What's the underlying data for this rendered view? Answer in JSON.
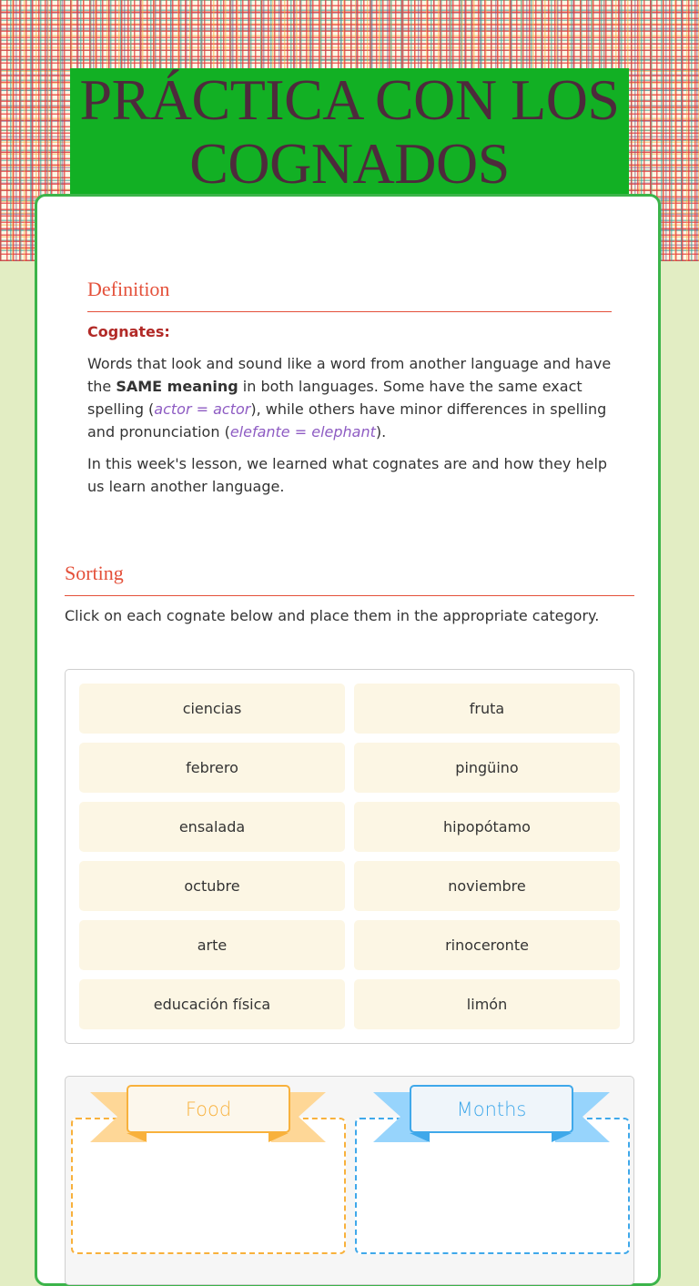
{
  "header": {
    "title_line1": "PRÁCTICA CON LOS",
    "title_line2": "COGNADOS"
  },
  "definition": {
    "heading": "Definition",
    "term": "Cognates:",
    "para1": {
      "a": "Words that look and sound like a word from another language and have the ",
      "bold": "SAME meaning",
      "b": " in both languages.  Some have the same exact spelling (",
      "ex1a": "actor",
      "eq1": " = ",
      "ex1b": "actor",
      "c": "), while others have minor differences in spelling and pronunciation (",
      "ex2a": "elefante",
      "eq2": " = ",
      "ex2b": "elephant",
      "d": ")."
    },
    "para2": "In this week's lesson, we learned what cognates are and how they help us learn another language."
  },
  "sorting": {
    "heading": "Sorting",
    "instructions": "Click on each cognate below and place them in the appropriate category.",
    "items": [
      "ciencias",
      "fruta",
      "febrero",
      "pingüino",
      "ensalada",
      "hipopótamo",
      "octubre",
      "noviembre",
      "arte",
      "rinoceronte",
      "educación física",
      "limón"
    ],
    "categories": [
      {
        "label": "Food",
        "color": "#f8b13c"
      },
      {
        "label": "Months",
        "color": "#3fa8ea"
      }
    ]
  }
}
